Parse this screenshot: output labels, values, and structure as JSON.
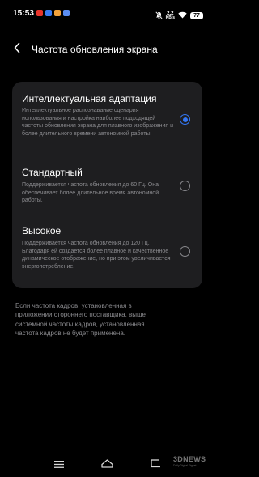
{
  "status_bar": {
    "time": "15:53",
    "notification_icons": [
      {
        "name": "yandex-icon",
        "color": "#e8342b"
      },
      {
        "name": "app-icon-blue",
        "color": "#3a7bf2"
      },
      {
        "name": "app-icon-orange",
        "color": "#f2a23a"
      },
      {
        "name": "app-icon-blue-2",
        "color": "#5a8cf0"
      }
    ],
    "net_speed_value": "2,2",
    "net_speed_unit": "KB/s",
    "battery": "77"
  },
  "header": {
    "title": "Частота обновления экрана"
  },
  "options": [
    {
      "title": "Интеллектуальная адаптация",
      "description": "Интеллектуальное распознавание сценария использования и настройка наиболее подходящей частоты обновления экрана для плавного изображения и более длительного времени автономной работы.",
      "selected": true
    },
    {
      "title": "Стандартный",
      "description": "Поддерживается частота обновления до 60 Гц. Она обеспечивает более длительное время автономной работы.",
      "selected": false
    },
    {
      "title": "Высокое",
      "description": "Поддерживается частота обновления до 120 Гц. Благодаря ей создается более плавное и качественное динамическое отображение, но при этом увеличивается энергопотребление.",
      "selected": false
    }
  ],
  "footnote": "Если частота кадров, установленная в приложении стороннего поставщика, выше системной частоты кадров, установленная частота кадров не будет применена.",
  "colors": {
    "accent": "#3478f6",
    "card_background": "#1e1e20",
    "secondary_text": "#8b8b8f"
  },
  "watermark": {
    "logo": "3DNEWS",
    "tagline": "Daily Digital Digest"
  }
}
